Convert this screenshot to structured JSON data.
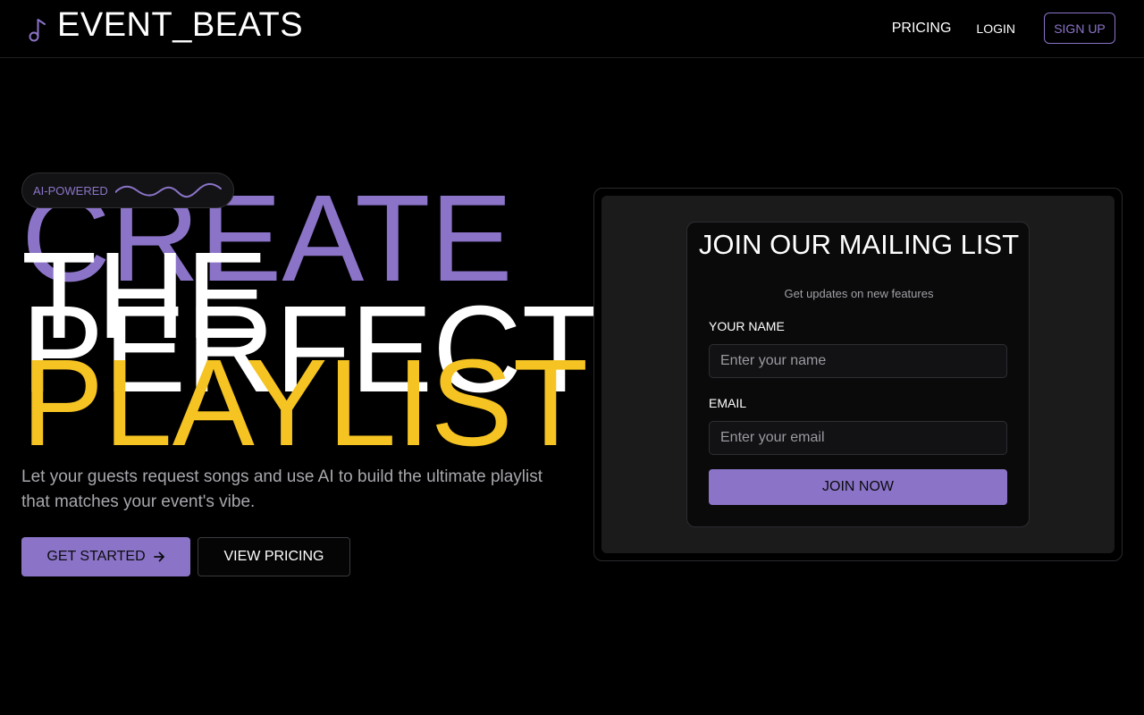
{
  "header": {
    "logo_icon": "music-note-icon",
    "logo_text": "EVENT_BEATS",
    "nav": {
      "pricing": "PRICING",
      "login": "LOGIN",
      "signup": "SIGN UP"
    }
  },
  "hero": {
    "badge": {
      "label": "AI-POWERED",
      "icon": "sound-wave-icon"
    },
    "headline": {
      "line1": "CREATE",
      "line2": "THE",
      "line3": "PERFECT",
      "line4": "PLAYLIST"
    },
    "subtitle": "Let your guests request songs and use AI to build the ultimate playlist that matches your event's vibe.",
    "cta_primary": "GET STARTED",
    "cta_primary_icon": "arrow-right-icon",
    "cta_secondary": "VIEW PRICING"
  },
  "mailing_list": {
    "title": "JOIN OUR MAILING LIST",
    "subtitle": "Get updates on new features",
    "name_label": "YOUR NAME",
    "name_placeholder": "Enter your name",
    "name_value": "",
    "email_label": "EMAIL",
    "email_placeholder": "Enter your email",
    "email_value": "",
    "submit": "JOIN NOW"
  },
  "colors": {
    "background": "#000000",
    "accent_purple": "#8b74c8",
    "accent_yellow": "#f5c322",
    "muted_text": "#a7a7ad",
    "panel": "#1b1b1c"
  }
}
